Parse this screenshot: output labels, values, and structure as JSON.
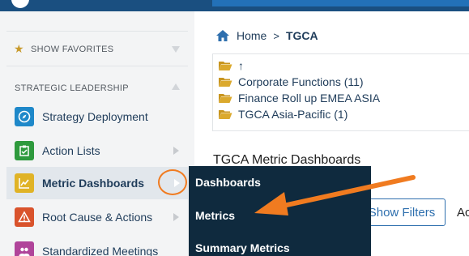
{
  "sidebar": {
    "favorites_label": "SHOW FAVORITES",
    "section_label": "STRATEGIC LEADERSHIP",
    "items": [
      {
        "label": "Strategy Deployment",
        "icon": "compass-icon",
        "color": "#1e88c9"
      },
      {
        "label": "Action Lists",
        "icon": "clipboard-check-icon",
        "color": "#2e9a3d"
      },
      {
        "label": "Metric Dashboards",
        "icon": "line-chart-icon",
        "color": "#e0b326"
      },
      {
        "label": "Root Cause & Actions",
        "icon": "warning-icon",
        "color": "#d9532c"
      },
      {
        "label": "Standardized Meetings",
        "icon": "people-icon",
        "color": "#b0449a"
      }
    ]
  },
  "breadcrumb": {
    "home": "Home",
    "separator": ">",
    "current": "TGCA"
  },
  "folders": [
    {
      "label": "↑"
    },
    {
      "label": "Corporate Functions (11)"
    },
    {
      "label": "Finance Roll up EMEA ASIA"
    },
    {
      "label": "TGCA Asia-Pacific (1)"
    }
  ],
  "main": {
    "dashboards_title": "TGCA Metric Dashboards",
    "show_filters_label": "Show Filters",
    "truncated_text": "Ac"
  },
  "flyout": {
    "items": [
      "Dashboards",
      "Metrics",
      "Summary Metrics"
    ]
  },
  "colors": {
    "accent": "#f07b20",
    "flyout_bg": "#0f2a3e",
    "topbar": "#1a4f80",
    "folder": "#c8951e"
  }
}
